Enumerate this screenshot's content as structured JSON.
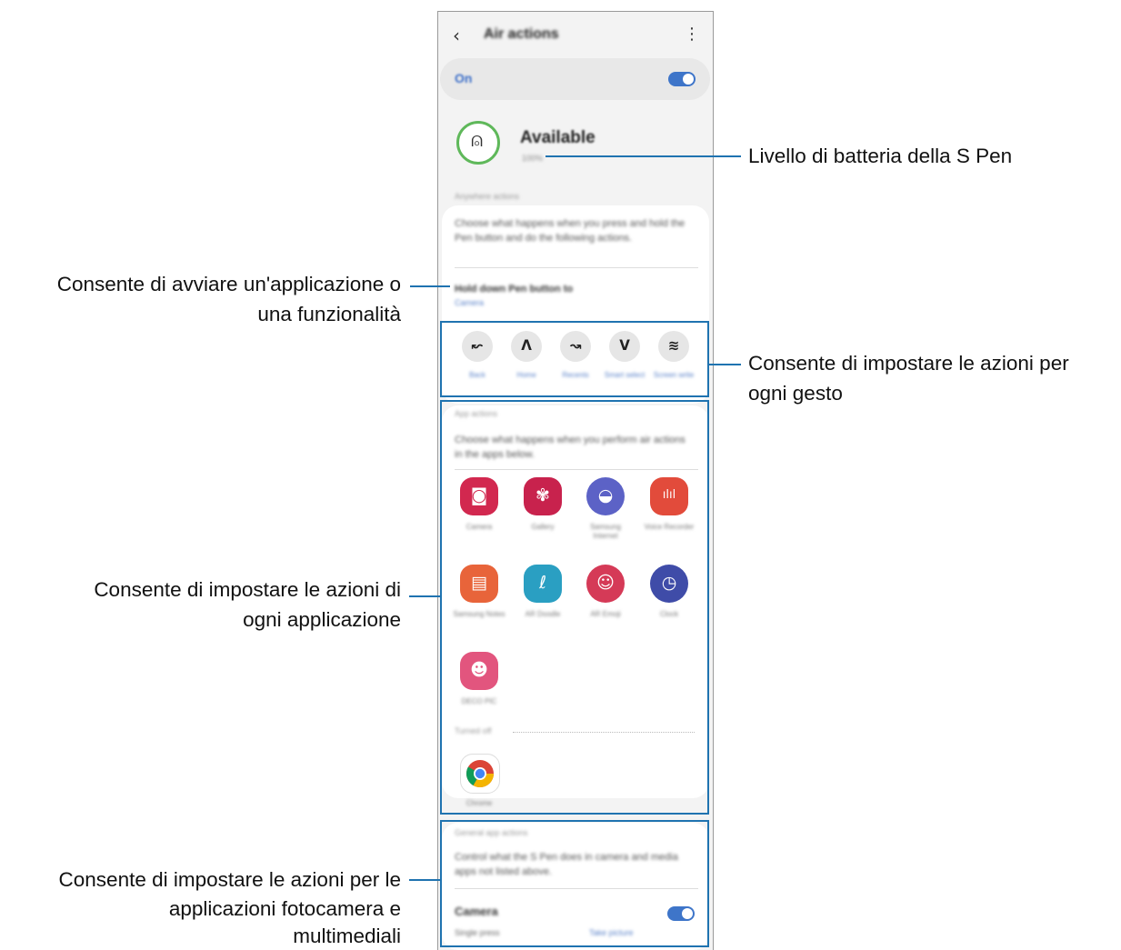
{
  "phone": {
    "topbar": {
      "back_icon": "chevron-left-icon",
      "title": "Air actions",
      "more_icon": "more-vert-icon"
    },
    "master_switch": {
      "label": "On",
      "state": true
    },
    "pen_status": {
      "title": "Available",
      "subtitle": "100%",
      "icon": "s-pen-icon"
    },
    "anywhere": {
      "header": "Anywhere actions",
      "description": "Choose what happens when you press and hold the Pen button and do the following actions.",
      "hold_title": "Hold down Pen button to",
      "hold_value": "Camera",
      "gestures": [
        {
          "icon": "gesture-left-icon",
          "glyph": "↜",
          "label": "Back"
        },
        {
          "icon": "gesture-up-icon",
          "glyph": "ᐱ",
          "label": "Home"
        },
        {
          "icon": "gesture-right-icon",
          "glyph": "↝",
          "label": "Recents"
        },
        {
          "icon": "gesture-updown-icon",
          "glyph": "ᐯ",
          "label": "Smart select"
        },
        {
          "icon": "gesture-zigzag-icon",
          "glyph": "≋",
          "label": "Screen write"
        }
      ]
    },
    "app_actions": {
      "header": "App actions",
      "description": "Choose what happens when you perform air actions in the apps below.",
      "apps": [
        {
          "icon": "camera-icon",
          "label": "Camera",
          "color": "#d2284f",
          "glyph": "◙"
        },
        {
          "icon": "gallery-icon",
          "label": "Gallery",
          "color": "#c8224d",
          "glyph": "✾"
        },
        {
          "icon": "samsung-internet-icon",
          "label": "Samsung Internet",
          "color": "#5c62c6",
          "glyph": "◒"
        },
        {
          "icon": "voice-recorder-icon",
          "label": "Voice Recorder",
          "color": "#e24b3b",
          "glyph": "ılıl"
        },
        {
          "icon": "samsung-notes-icon",
          "label": "Samsung Notes",
          "color": "#e8643a",
          "glyph": "▤"
        },
        {
          "icon": "ar-doodle-icon",
          "label": "AR Doodle",
          "color": "#2a9fc2",
          "glyph": "ℓ"
        },
        {
          "icon": "ar-emoji-icon",
          "label": "AR Emoji",
          "color": "#d53a57",
          "glyph": "☺"
        },
        {
          "icon": "clock-icon",
          "label": "Clock",
          "color": "#3f4ca8",
          "glyph": "◷"
        },
        {
          "icon": "deco-pic-icon",
          "label": "DECO PIC",
          "color": "#e2557e",
          "glyph": "☻"
        }
      ],
      "turned_off_label": "Turned off",
      "turned_off_apps": [
        {
          "icon": "chrome-icon",
          "label": "Chrome"
        }
      ]
    },
    "general": {
      "header": "General app actions",
      "description": "Control what the S Pen does in camera and media apps not listed above.",
      "camera_label": "Camera",
      "camera_state": true,
      "single_press_label": "Single press",
      "single_press_value": "Take picture"
    }
  },
  "callouts": {
    "battery": "Livello di batteria della S Pen",
    "launch_line1": "Consente di avviare un'applicazione o",
    "launch_line2": "una funzionalità",
    "gesture_line1": "Consente di impostare le azioni per",
    "gesture_line2": "ogni gesto",
    "apps_line1": "Consente di impostare le azioni di",
    "apps_line2": "ogni applicazione",
    "media_line1": "Consente di impostare le azioni per le",
    "media_line2": "applicazioni fotocamera e",
    "media_line3": "multimediali"
  },
  "colors": {
    "accent": "#1f73b0",
    "toggle": "#3e75c9",
    "battery_ring": "#5fb85a"
  }
}
